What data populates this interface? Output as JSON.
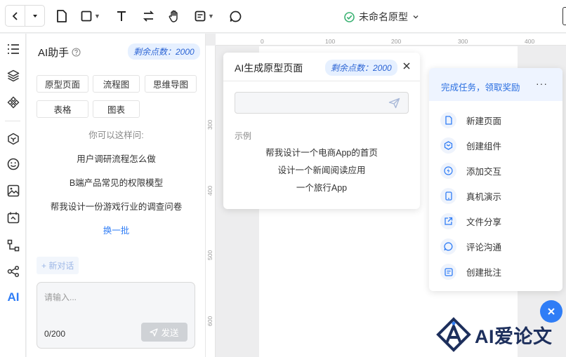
{
  "topbar": {
    "doc_title": "未命名原型"
  },
  "ai_panel": {
    "title": "AI助手",
    "points_label": "剩余点数：2000",
    "chips": [
      "原型页面",
      "流程图",
      "思维导图",
      "表格",
      "图表"
    ],
    "hint": "你可以这样问:",
    "suggestions": [
      "用户调研流程怎么做",
      "B端产品常见的权限模型",
      "帮我设计一份游戏行业的调查问卷"
    ],
    "refresh": "换一批",
    "new_chat": "+ 新对话",
    "input_placeholder": "请输入...",
    "char_count": "0/200",
    "send_label": "发送"
  },
  "rulers": {
    "top": [
      "0",
      "100",
      "200",
      "300",
      "400"
    ],
    "left": [
      "300",
      "400",
      "500",
      "600"
    ]
  },
  "generate_popup": {
    "title": "AI生成原型页面",
    "points_label": "剩余点数：2000",
    "examples_label": "示例",
    "examples": [
      "帮我设计一个电商App的首页",
      "设计一个新闻阅读应用",
      "一个旅行App"
    ]
  },
  "task_panel": {
    "title": "完成任务，领取奖励",
    "more": "···",
    "items": [
      {
        "label": "新建页面",
        "icon": "file-icon"
      },
      {
        "label": "创建组件",
        "icon": "component-icon"
      },
      {
        "label": "添加交互",
        "icon": "lightning-icon"
      },
      {
        "label": "真机演示",
        "icon": "phone-icon"
      },
      {
        "label": "文件分享",
        "icon": "share-icon"
      },
      {
        "label": "评论沟通",
        "icon": "comment-icon"
      },
      {
        "label": "创建批注",
        "icon": "note-icon"
      }
    ]
  },
  "watermark": {
    "text": "AI爱论文"
  },
  "colors": {
    "accent": "#2f7df6",
    "brand_dark": "#1d2f5c",
    "success": "#3bb273",
    "badge_bg": "#e6f0ff"
  }
}
